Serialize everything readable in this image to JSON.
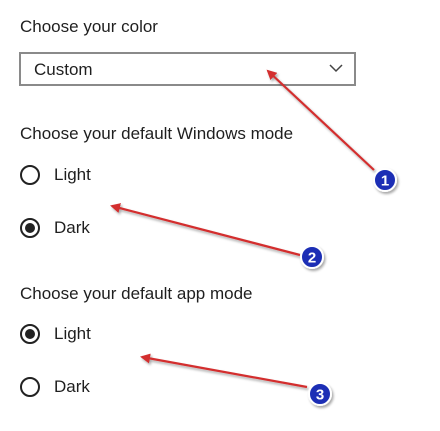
{
  "color_section": {
    "heading": "Choose your color",
    "selected_value": "Custom"
  },
  "windows_mode": {
    "heading": "Choose your default Windows mode",
    "options": [
      {
        "label": "Light",
        "checked": false
      },
      {
        "label": "Dark",
        "checked": true
      }
    ]
  },
  "app_mode": {
    "heading": "Choose your default app mode",
    "options": [
      {
        "label": "Light",
        "checked": true
      },
      {
        "label": "Dark",
        "checked": false
      }
    ]
  },
  "annotations": {
    "badges": [
      "1",
      "2",
      "3"
    ],
    "arrow_color": "#d32f2f",
    "badge_color": "#1a2fb5"
  },
  "icons": {
    "dropdown": "chevron-down-icon"
  }
}
